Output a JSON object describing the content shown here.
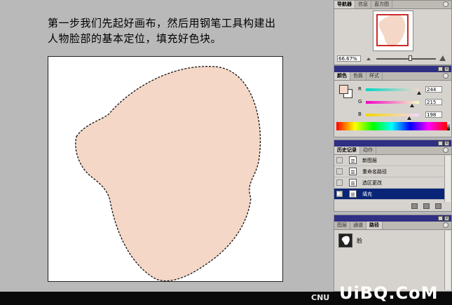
{
  "caption": {
    "line1": "第一步我们先起好画布，然后用钢笔工具构建出",
    "line2": "人物脸部的基本定位，填充好色块。"
  },
  "colors": {
    "fill": "#f4d7c6",
    "titlebar": "#2f2f84",
    "selected": "#0a2577"
  },
  "navigator": {
    "tabs": [
      "导航器",
      "信息",
      "直方图"
    ],
    "zoom": "66.67%"
  },
  "color_panel": {
    "tabs": [
      "颜色",
      "色板",
      "样式"
    ],
    "channels": [
      {
        "label": "R",
        "value": "244"
      },
      {
        "label": "G",
        "value": "215"
      },
      {
        "label": "B",
        "value": "198"
      }
    ]
  },
  "history_panel": {
    "tabs": [
      "历史记录",
      "动作"
    ],
    "items": [
      "新图层",
      "重命名路径",
      "选区更改",
      "填充"
    ],
    "selected_index": 3
  },
  "paths_panel": {
    "tabs": [
      "图层",
      "通道",
      "路径"
    ],
    "path_name": "脸"
  },
  "watermark": {
    "left": "CNU",
    "right": "UiBQ.CoM"
  }
}
